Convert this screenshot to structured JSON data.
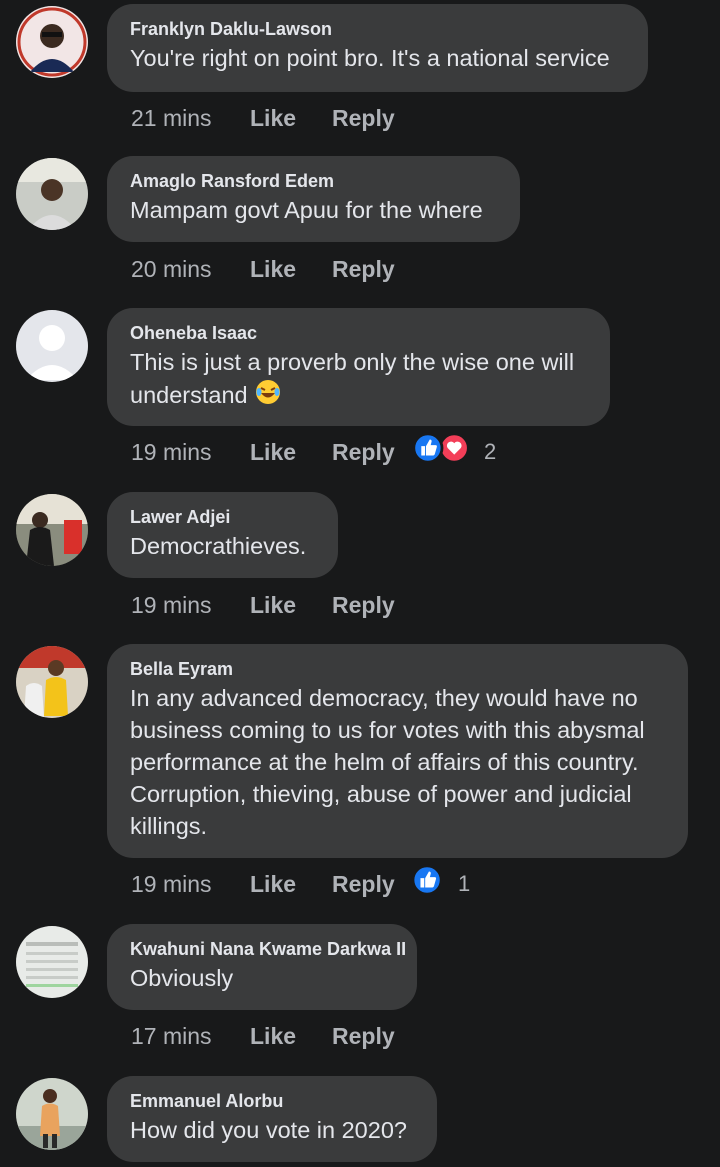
{
  "comments": [
    {
      "name": "Franklyn Daklu-Lawson",
      "text": "You're right on point bro. It's a national service",
      "time": "21 mins",
      "like": "Like",
      "reply": "Reply"
    },
    {
      "name": "Amaglo Ransford Edem",
      "text": "Mampam govt Apuu for the where",
      "time": "20 mins",
      "like": "Like",
      "reply": "Reply"
    },
    {
      "name": "Oheneba Isaac",
      "text": "This is just a proverb only the wise one will understand",
      "time": "19 mins",
      "like": "Like",
      "reply": "Reply",
      "reaction_count": "2",
      "reactions": [
        "like-icon",
        "love-icon"
      ]
    },
    {
      "name": "Lawer Adjei",
      "text": "Democrathieves.",
      "time": "19 mins",
      "like": "Like",
      "reply": "Reply"
    },
    {
      "name": "Bella Eyram",
      "text": "In any advanced democracy, they would have no business coming to us for votes with this abysmal performance at the helm of affairs of this country. Corruption, thieving, abuse of power and judicial killings.",
      "time": "19 mins",
      "like": "Like",
      "reply": "Reply",
      "reaction_count": "1",
      "reactions": [
        "like-icon"
      ]
    },
    {
      "name": "Kwahuni Nana Kwame Darkwa II",
      "text": "Obviously",
      "time": "17 mins",
      "like": "Like",
      "reply": "Reply"
    },
    {
      "name": "Emmanuel Alorbu",
      "text": "How did you vote in 2020?"
    }
  ],
  "colors": {
    "background": "#18191a",
    "bubble": "#3a3b3c",
    "like_blue": "#1877f2",
    "love_red": "#f33e58"
  }
}
